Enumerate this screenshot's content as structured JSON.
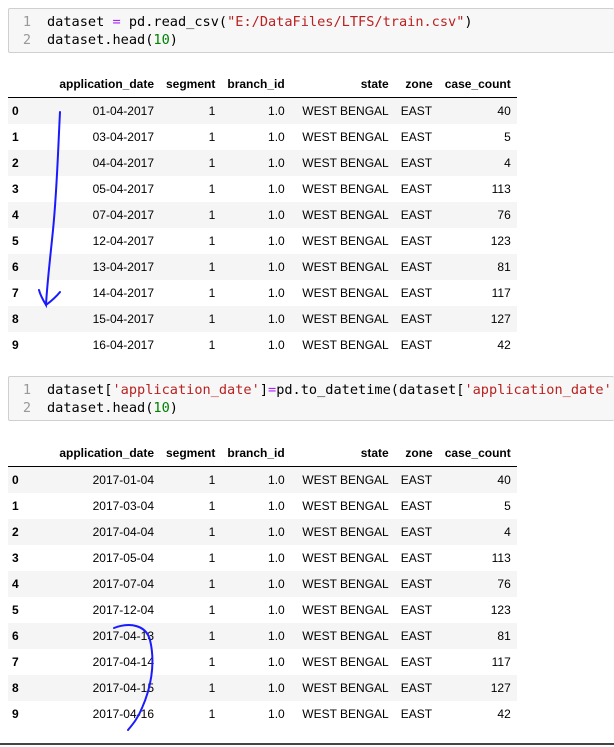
{
  "cells": [
    {
      "lines": [
        {
          "num": "1",
          "tokens": [
            {
              "t": "dataset ",
              "c": "tok-name"
            },
            {
              "t": "=",
              "c": "tok-op"
            },
            {
              "t": " pd.read_csv(",
              "c": "tok-name"
            },
            {
              "t": "\"E:/DataFiles/LTFS/train.csv\"",
              "c": "tok-str"
            },
            {
              "t": ")",
              "c": "tok-name"
            }
          ]
        },
        {
          "num": "2",
          "tokens": [
            {
              "t": "dataset.head(",
              "c": "tok-name"
            },
            {
              "t": "10",
              "c": "tok-num"
            },
            {
              "t": ")",
              "c": "tok-name"
            }
          ]
        }
      ]
    },
    {
      "lines": [
        {
          "num": "1",
          "tokens": [
            {
              "t": "dataset[",
              "c": "tok-name"
            },
            {
              "t": "'application_date'",
              "c": "tok-str"
            },
            {
              "t": "]",
              "c": "tok-name"
            },
            {
              "t": "=",
              "c": "tok-op"
            },
            {
              "t": "pd.to_datetime(dataset[",
              "c": "tok-name"
            },
            {
              "t": "'application_date'",
              "c": "tok-str"
            },
            {
              "t": "])",
              "c": "tok-name"
            }
          ]
        },
        {
          "num": "2",
          "tokens": [
            {
              "t": "dataset.head(",
              "c": "tok-name"
            },
            {
              "t": "10",
              "c": "tok-num"
            },
            {
              "t": ")",
              "c": "tok-name"
            }
          ]
        }
      ]
    }
  ],
  "columns": [
    "application_date",
    "segment",
    "branch_id",
    "state",
    "zone",
    "case_count"
  ],
  "tables": [
    {
      "rows": [
        [
          "0",
          "01-04-2017",
          "1",
          "1.0",
          "WEST BENGAL",
          "EAST",
          "40"
        ],
        [
          "1",
          "03-04-2017",
          "1",
          "1.0",
          "WEST BENGAL",
          "EAST",
          "5"
        ],
        [
          "2",
          "04-04-2017",
          "1",
          "1.0",
          "WEST BENGAL",
          "EAST",
          "4"
        ],
        [
          "3",
          "05-04-2017",
          "1",
          "1.0",
          "WEST BENGAL",
          "EAST",
          "113"
        ],
        [
          "4",
          "07-04-2017",
          "1",
          "1.0",
          "WEST BENGAL",
          "EAST",
          "76"
        ],
        [
          "5",
          "12-04-2017",
          "1",
          "1.0",
          "WEST BENGAL",
          "EAST",
          "123"
        ],
        [
          "6",
          "13-04-2017",
          "1",
          "1.0",
          "WEST BENGAL",
          "EAST",
          "81"
        ],
        [
          "7",
          "14-04-2017",
          "1",
          "1.0",
          "WEST BENGAL",
          "EAST",
          "117"
        ],
        [
          "8",
          "15-04-2017",
          "1",
          "1.0",
          "WEST BENGAL",
          "EAST",
          "127"
        ],
        [
          "9",
          "16-04-2017",
          "1",
          "1.0",
          "WEST BENGAL",
          "EAST",
          "42"
        ]
      ]
    },
    {
      "rows": [
        [
          "0",
          "2017-01-04",
          "1",
          "1.0",
          "WEST BENGAL",
          "EAST",
          "40"
        ],
        [
          "1",
          "2017-03-04",
          "1",
          "1.0",
          "WEST BENGAL",
          "EAST",
          "5"
        ],
        [
          "2",
          "2017-04-04",
          "1",
          "1.0",
          "WEST BENGAL",
          "EAST",
          "4"
        ],
        [
          "3",
          "2017-05-04",
          "1",
          "1.0",
          "WEST BENGAL",
          "EAST",
          "113"
        ],
        [
          "4",
          "2017-07-04",
          "1",
          "1.0",
          "WEST BENGAL",
          "EAST",
          "76"
        ],
        [
          "5",
          "2017-12-04",
          "1",
          "1.0",
          "WEST BENGAL",
          "EAST",
          "123"
        ],
        [
          "6",
          "2017-04-13",
          "1",
          "1.0",
          "WEST BENGAL",
          "EAST",
          "81"
        ],
        [
          "7",
          "2017-04-14",
          "1",
          "1.0",
          "WEST BENGAL",
          "EAST",
          "117"
        ],
        [
          "8",
          "2017-04-15",
          "1",
          "1.0",
          "WEST BENGAL",
          "EAST",
          "127"
        ],
        [
          "9",
          "2017-04-16",
          "1",
          "1.0",
          "WEST BENGAL",
          "EAST",
          "42"
        ]
      ]
    }
  ],
  "annotation_color": "#1a1aff"
}
